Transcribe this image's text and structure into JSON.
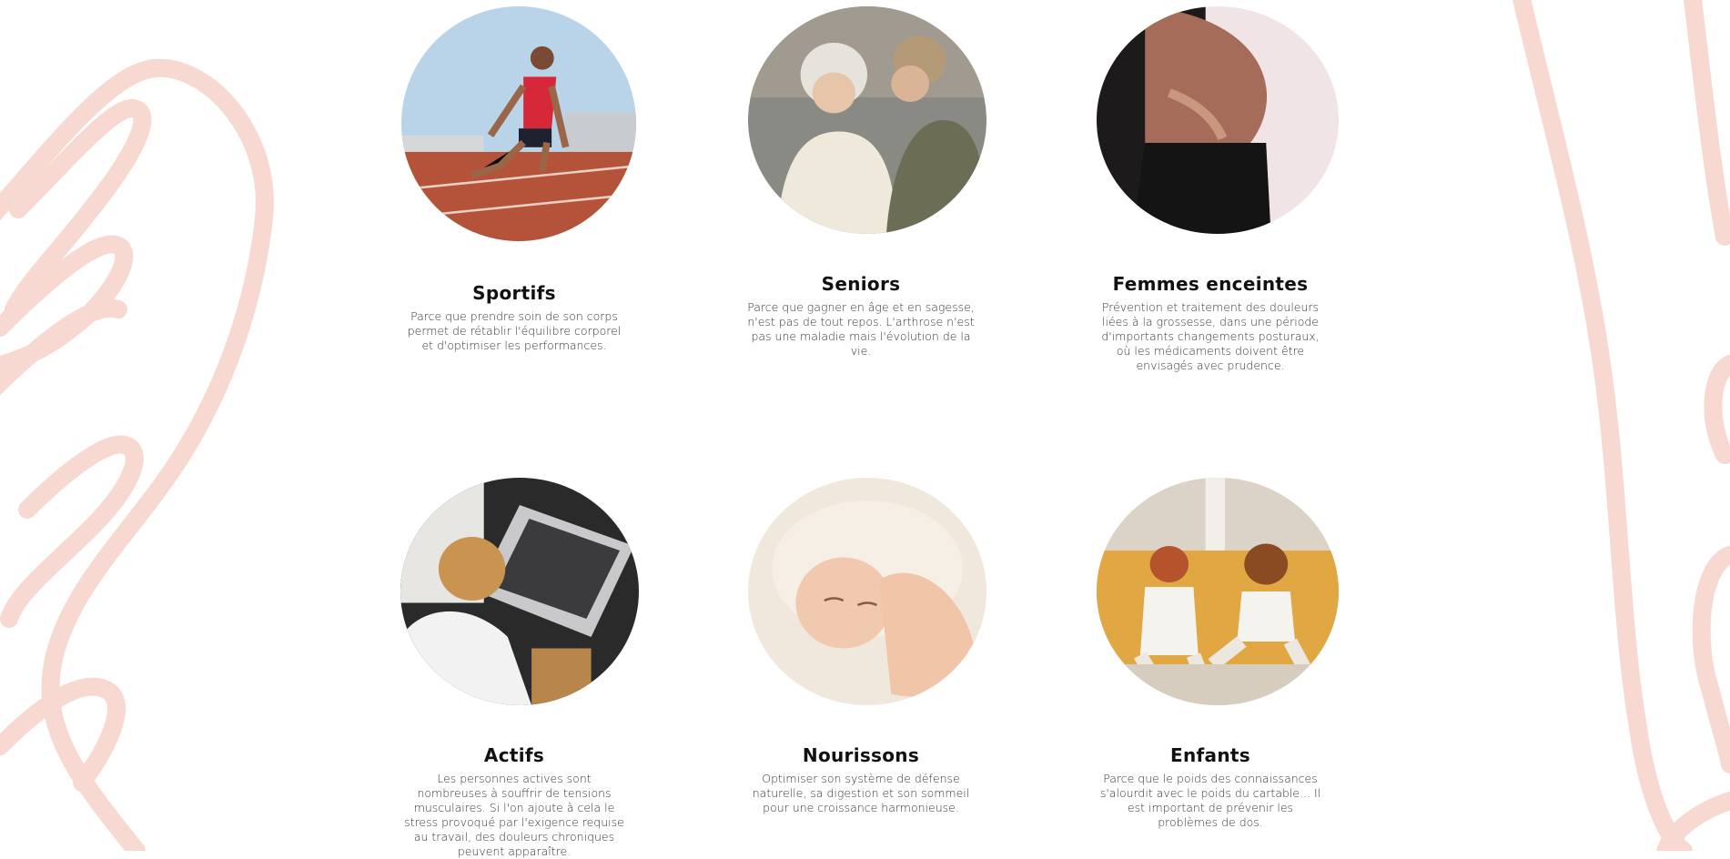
{
  "colors": {
    "decoration": "#f7d9d2",
    "heading": "#111111",
    "text": "#333333"
  },
  "categories": [
    {
      "title": "Sportifs",
      "description": "Parce que prendre soin de son corps permet de rétablir l'équilibre corporel et d'optimiser les performances.",
      "image": "sprinter-photo"
    },
    {
      "title": "Seniors",
      "description": "Parce que gagner en âge et en sagesse, n'est pas de tout repos. L'arthrose n'est pas une maladie mais l'évolution de la vie.",
      "image": "seniors-photo"
    },
    {
      "title": "Femmes enceintes",
      "description": "Prévention et traitement des douleurs liées à la grossesse, dans une période d'importants changements posturaux, où les médicaments doivent être envisagés avec prudence.",
      "image": "pregnant-belly-photo"
    },
    {
      "title": "Actifs",
      "description": "Les personnes actives sont nombreuses à souffrir de tensions musculaires. Si l'on ajoute à cela le stress provoqué par l'exigence requise au travail, des douleurs chroniques peuvent apparaître.",
      "image": "stressed-worker-photo"
    },
    {
      "title": "Nourissons",
      "description": "Optimiser son système de défense naturelle, sa digestion et son sommeil pour une croissance harmonieuse.",
      "image": "sleeping-baby-photo"
    },
    {
      "title": "Enfants",
      "description": "Parce que le poids des connaissances s'alourdit avec le poids du cartable... Il est important de prévenir les problèmes de dos.",
      "image": "children-photo"
    }
  ]
}
